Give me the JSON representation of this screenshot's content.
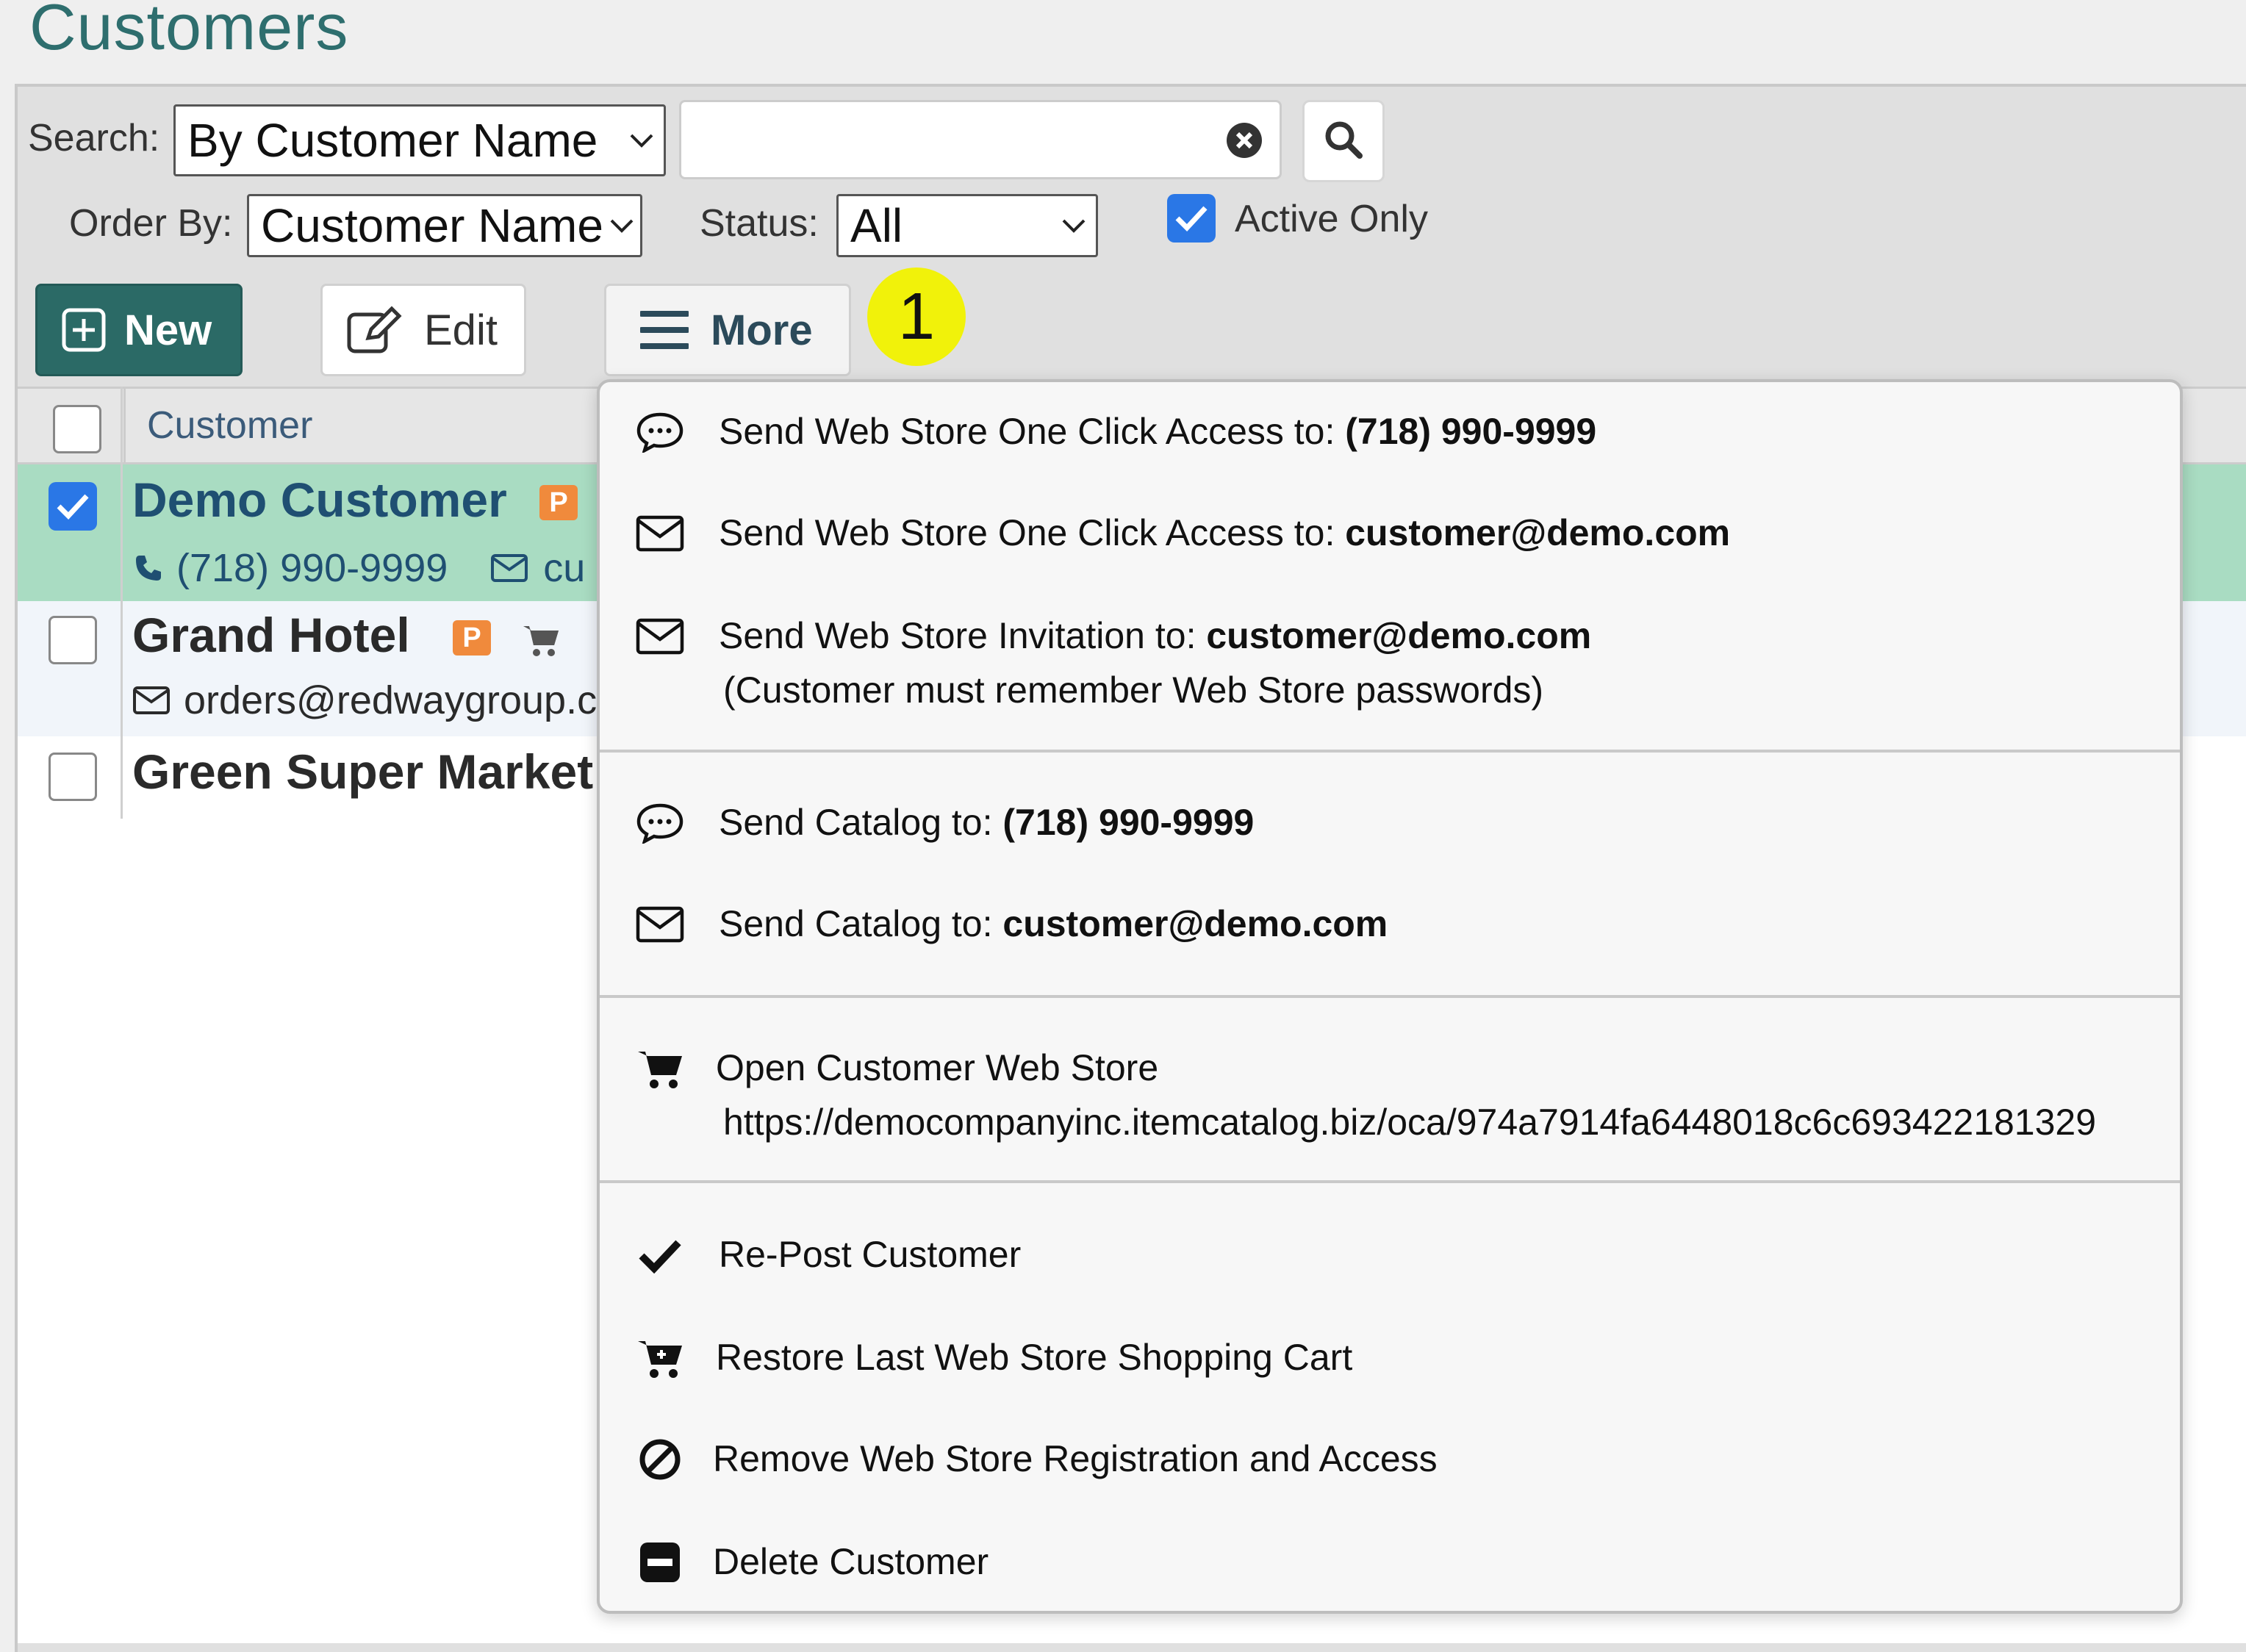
{
  "page": {
    "title": "Customers"
  },
  "search": {
    "label": "Search:",
    "by_value": "By Customer Name",
    "query_value": "",
    "order_label": "Order By:",
    "order_value": "Customer Name",
    "status_label": "Status:",
    "status_value": "All",
    "active_only_label": "Active Only",
    "active_only_checked": true
  },
  "toolbar": {
    "new_label": "New",
    "edit_label": "Edit",
    "more_label": "More",
    "callout_number": "1"
  },
  "table": {
    "column_header": "Customer",
    "rows": [
      {
        "name": "Demo Customer",
        "badge": "P",
        "phone": "(718) 990-9999",
        "email_partial": "cu",
        "selected": true
      },
      {
        "name": "Grand Hotel",
        "badge": "P",
        "email_partial": "orders@redwaygroup.c",
        "selected": false
      },
      {
        "name": "Green Super Market",
        "selected": false
      }
    ]
  },
  "more_menu": {
    "items": [
      {
        "icon": "chat-bubble-icon",
        "prefix": "Send Web Store One Click Access to: ",
        "target": "(718) 990-9999"
      },
      {
        "icon": "envelope-icon",
        "prefix": "Send Web Store One Click Access to: ",
        "target": "customer@demo.com"
      },
      {
        "icon": "envelope-icon",
        "prefix": "Send Web Store Invitation to: ",
        "target": "customer@demo.com",
        "note": "(Customer must remember Web Store passwords)"
      },
      {
        "icon": "chat-bubble-icon",
        "prefix": "Send Catalog to: ",
        "target": "(718) 990-9999"
      },
      {
        "icon": "envelope-icon",
        "prefix": "Send Catalog to: ",
        "target": "customer@demo.com"
      },
      {
        "icon": "cart-icon",
        "label": "Open Customer Web Store",
        "note": "https://democompanyinc.itemcatalog.biz/oca/974a7914fa6448018c6c693422181329"
      },
      {
        "icon": "checkmark-icon",
        "label": "Re-Post Customer"
      },
      {
        "icon": "cart-restore-icon",
        "label": "Restore Last Web Store Shopping Cart"
      },
      {
        "icon": "ban-icon",
        "label": "Remove Web Store Registration and Access"
      },
      {
        "icon": "minus-square-icon",
        "label": "Delete Customer"
      }
    ]
  },
  "colors": {
    "brand_teal": "#2b6a66",
    "title_teal": "#2e6e6e",
    "selected_row": "#a9dcc2",
    "checkbox_blue": "#2a77e6",
    "callout_yellow": "#f1f20a",
    "badge_orange": "#f08a3c"
  }
}
